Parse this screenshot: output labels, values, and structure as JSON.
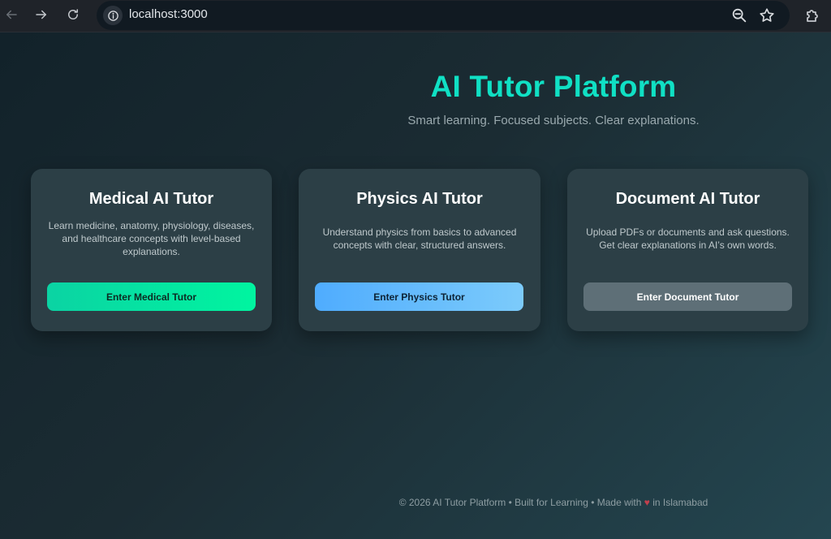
{
  "browser": {
    "url": "localhost:3000",
    "icons": {
      "back": "arrow-left-icon",
      "forward": "arrow-right-icon",
      "reload": "reload-icon",
      "site_info": "info-icon",
      "zoom": "zoom-icon",
      "bookmark": "star-icon",
      "extensions": "puzzle-icon"
    }
  },
  "hero": {
    "title": "AI Tutor Platform",
    "subtitle": "Smart learning. Focused subjects. Clear explanations."
  },
  "cards": [
    {
      "title": "Medical AI Tutor",
      "description": "Learn medicine, anatomy, physiology, diseases, and healthcare concepts with level-based explanations.",
      "button": "Enter Medical Tutor"
    },
    {
      "title": "Physics AI Tutor",
      "description": "Understand physics from basics to advanced concepts with clear, structured answers.",
      "button": "Enter Physics Tutor"
    },
    {
      "title": "Document AI Tutor",
      "description": "Upload PDFs or documents and ask questions. Get clear explanations in AI’s own words.",
      "button": "Enter Document Tutor"
    }
  ],
  "footer": {
    "left": "© 2026 AI Tutor Platform • Built for Learning • Made with",
    "heart": "♥",
    "right": "in Islamabad"
  },
  "colors": {
    "accent": "#10e0c4",
    "medical_button": "#00f5a0",
    "physics_button": "#4facfe",
    "document_button": "#5e6f77"
  }
}
